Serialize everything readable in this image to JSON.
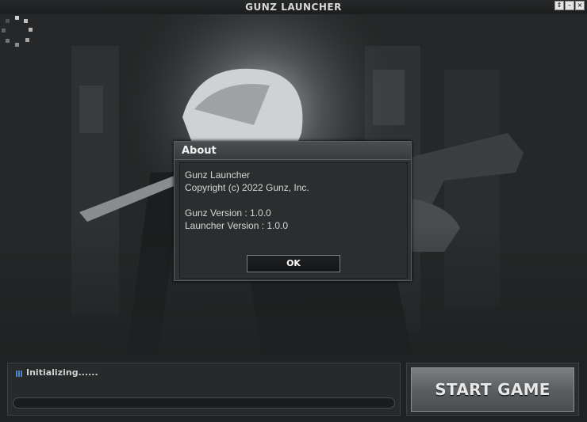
{
  "window": {
    "title": "GUNZ LAUNCHER",
    "restore_glyph": "⇕",
    "minimize_glyph": "–",
    "close_glyph": "×"
  },
  "about": {
    "title": "About",
    "app_name": "Gunz Launcher",
    "copyright": "Copyright (c) 2022 Gunz, Inc.",
    "gunz_version": "Gunz Version : 1.0.0",
    "launcher_version": "Launcher Version : 1.0.0",
    "ok_label": "OK"
  },
  "status": {
    "text": "Initializing......",
    "progress": 0
  },
  "start_button": {
    "label": "START GAME"
  },
  "icons": {
    "spinner": "loading-spinner-icon",
    "status": "status-grid-icon"
  }
}
